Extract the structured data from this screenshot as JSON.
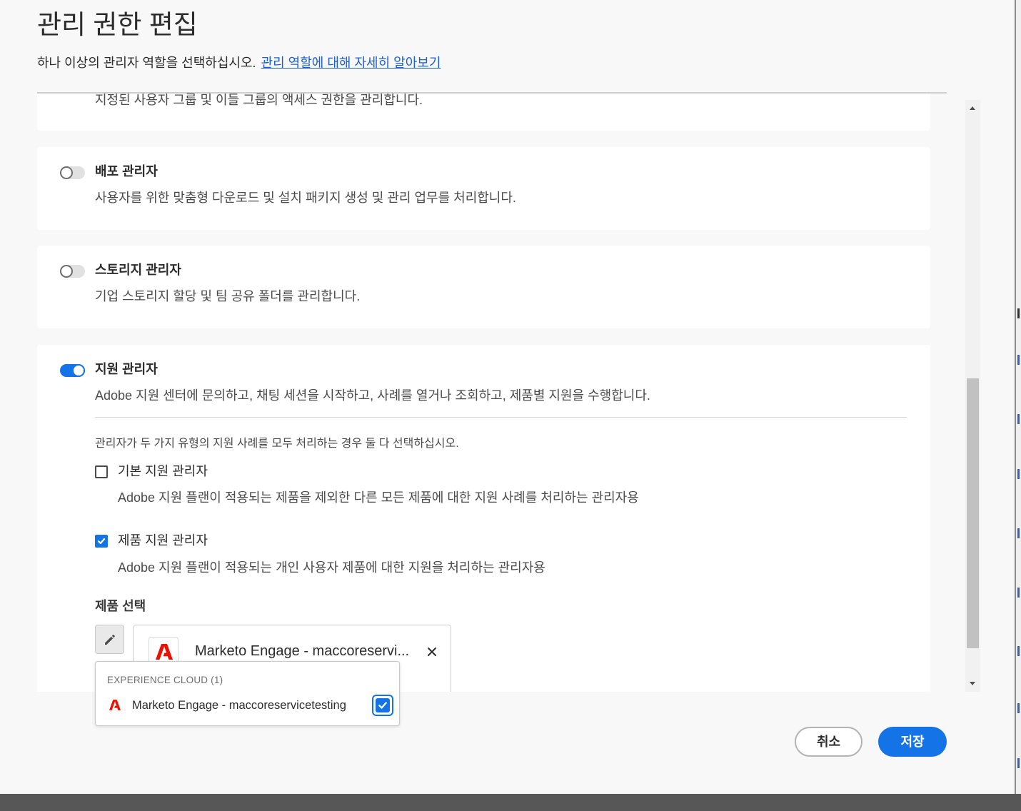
{
  "dialog": {
    "title": "관리 권한 편집",
    "subtitle": "하나 이상의 관리자 역할을 선택하십시오.",
    "learn_more_link": "관리 역할에 대해 자세히 알아보기"
  },
  "role_list": {
    "clipped_description": "지정된 사용자 그룹 및 이들 그룹의 액세스 권한을 관리합니다.",
    "roles": [
      {
        "name": "배포 관리자",
        "description": "사용자를 위한 맞춤형 다운로드 및 설치 패키지 생성 및 관리 업무를 처리합니다.",
        "enabled": false
      },
      {
        "name": "스토리지 관리자",
        "description": "기업 스토리지 할당 및 팀 공유 폴더를 관리합니다.",
        "enabled": false
      },
      {
        "name": "지원 관리자",
        "description": "Adobe 지원 센터에 문의하고, 채팅 세션을 시작하고, 사례를 열거나 조회하고, 제품별 지원을 수행합니다.",
        "enabled": true
      }
    ]
  },
  "support_admin": {
    "hint": "관리자가 두 가지 유형의 지원 사례를 모두 처리하는 경우 둘 다 선택하십시오.",
    "types": [
      {
        "label": "기본 지원 관리자",
        "description": "Adobe 지원 플랜이 적용되는 제품을 제외한 다른 모든 제품에 대한 지원 사례를 처리하는 관리자용",
        "checked": false
      },
      {
        "label": "제품 지원 관리자",
        "description": "Adobe 지원 플랜이 적용되는 개인 사용자 제품에 대한 지원을 처리하는 관리자용",
        "checked": true
      }
    ],
    "product_select_label": "제품 선택",
    "edit_icon": "pencil-icon",
    "selected_product": {
      "name": "Marketo Engage - maccoreservi...",
      "icon": "adobe-logo-icon",
      "remove_icon": "close-icon"
    }
  },
  "product_picker": {
    "group_label": "EXPERIENCE CLOUD (1)",
    "items": [
      {
        "name": "Marketo Engage - maccoreservicetesting",
        "icon": "adobe-logo-icon",
        "checked": true
      }
    ]
  },
  "footer": {
    "cancel_label": "취소",
    "save_label": "저장"
  },
  "colors": {
    "accent": "#1473e6",
    "adobe_red": "#eb1000",
    "text": "#2c2c2c"
  }
}
